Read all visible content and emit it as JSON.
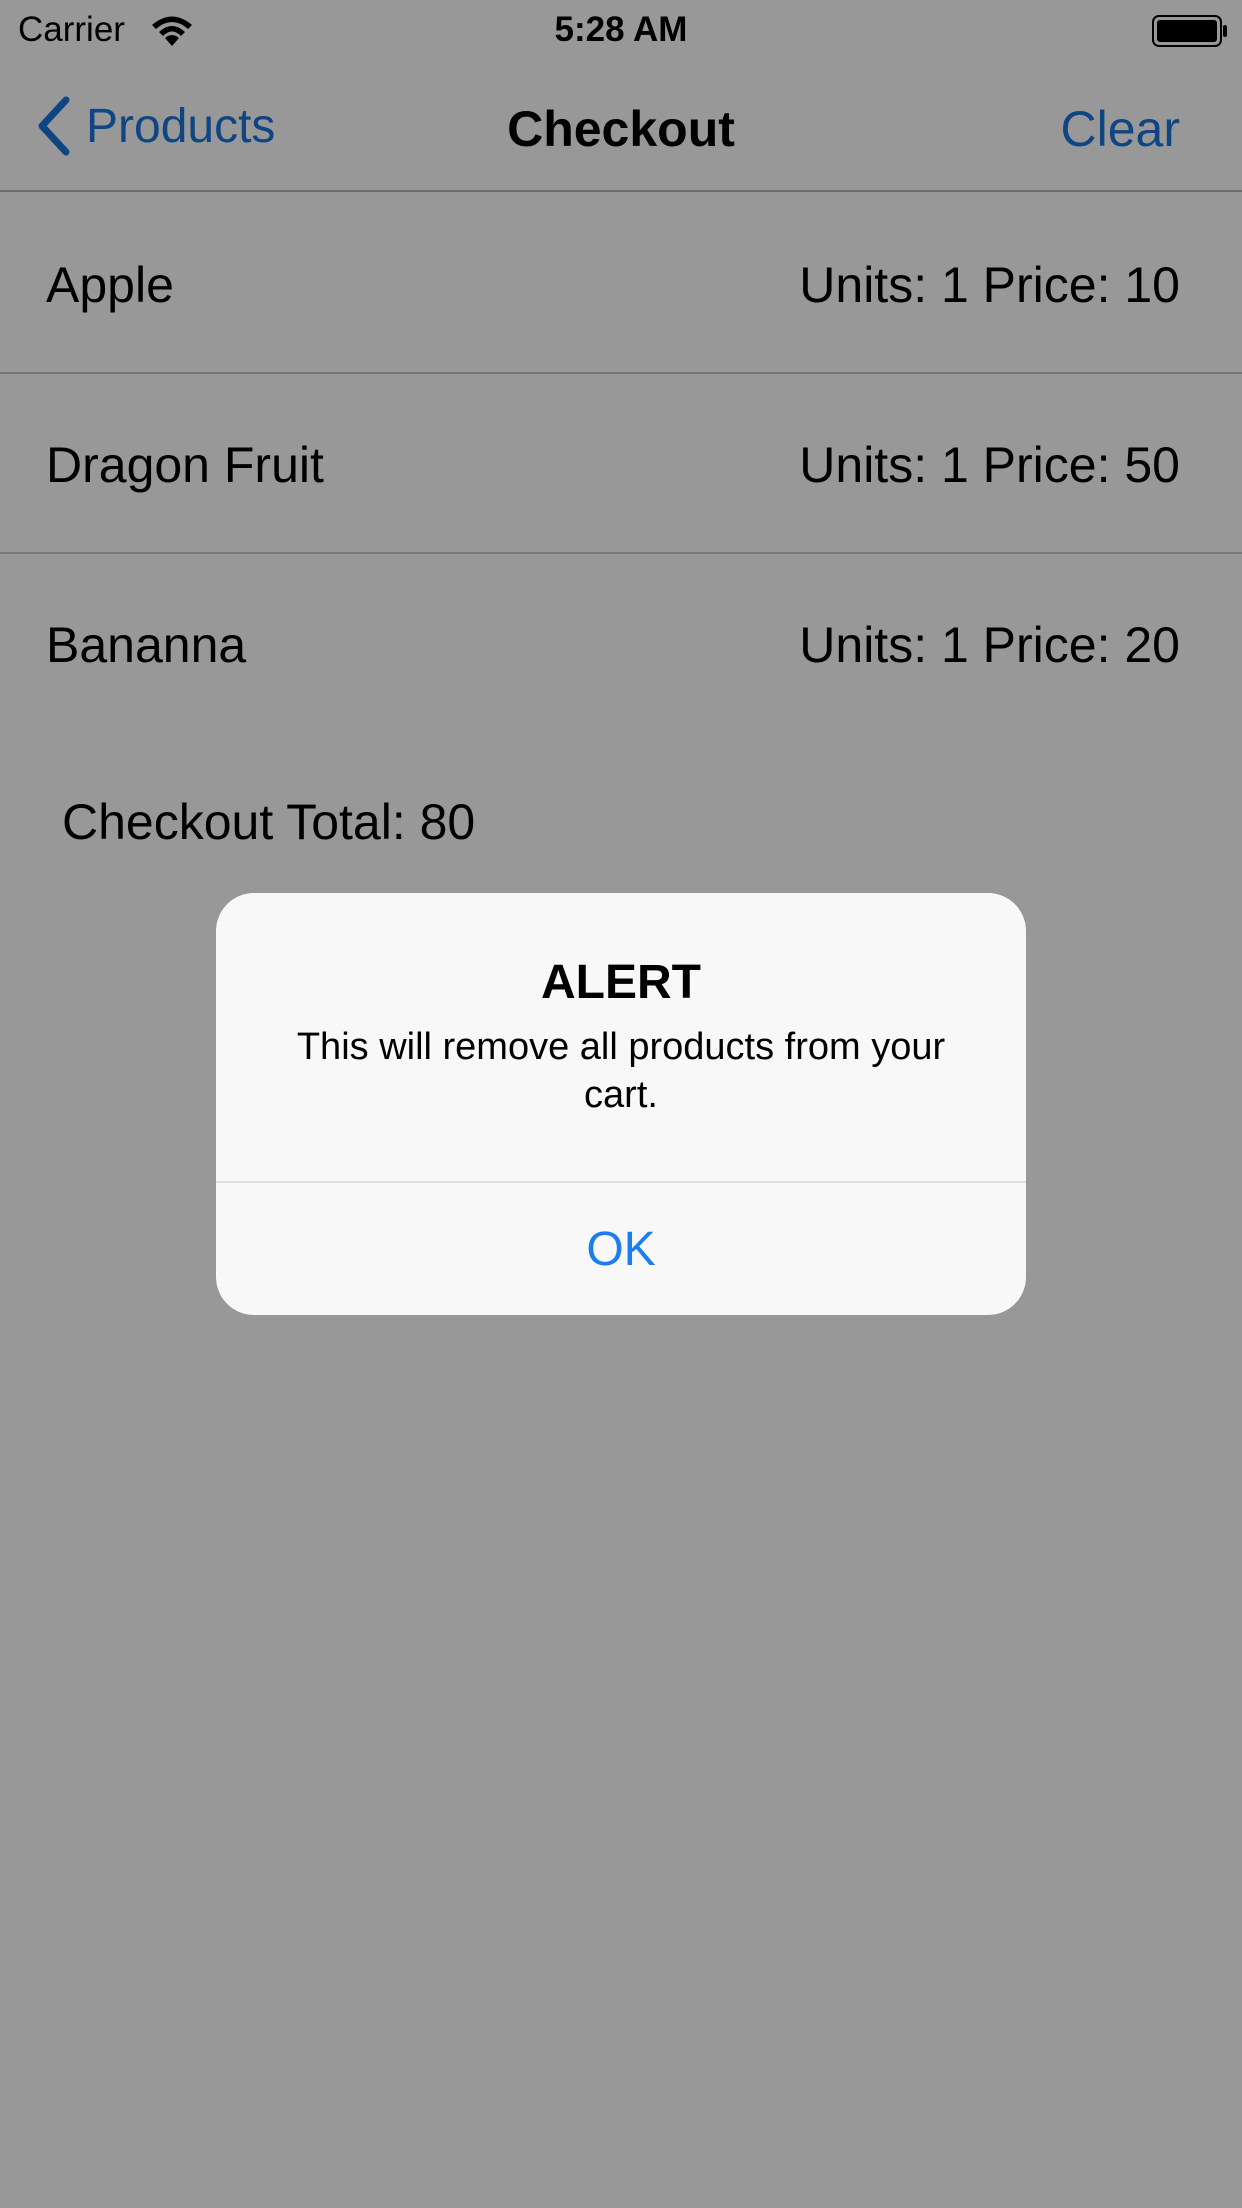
{
  "status_bar": {
    "carrier": "Carrier",
    "time": "5:28 AM"
  },
  "nav": {
    "back_label": "Products",
    "title": "Checkout",
    "action_label": "Clear"
  },
  "items": [
    {
      "name": "Apple",
      "detail": "Units: 1 Price: 10"
    },
    {
      "name": "Dragon Fruit",
      "detail": "Units: 1 Price: 50"
    },
    {
      "name": "Bananna",
      "detail": "Units: 1 Price: 20"
    }
  ],
  "total_label": "Checkout Total: 80",
  "alert": {
    "title": "ALERT",
    "message": "This will remove all products from your cart.",
    "ok_label": "OK"
  },
  "colors": {
    "tint": "#1a73d9",
    "alert_button": "#1a7df0",
    "overlay": "#999999"
  }
}
